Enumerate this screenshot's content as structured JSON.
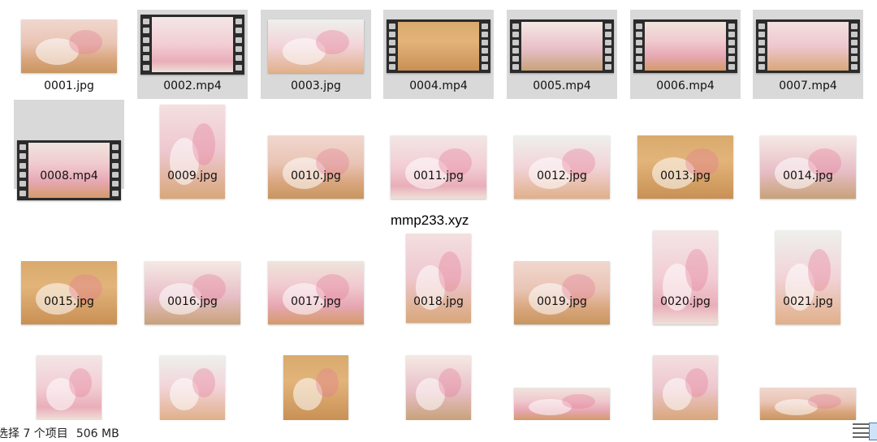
{
  "files": [
    {
      "name": "0001.jpg",
      "type": "image",
      "selected": false
    },
    {
      "name": "0002.mp4",
      "type": "video",
      "selected": true
    },
    {
      "name": "0003.jpg",
      "type": "image",
      "selected": true
    },
    {
      "name": "0004.mp4",
      "type": "video",
      "selected": true
    },
    {
      "name": "0005.mp4",
      "type": "video",
      "selected": true
    },
    {
      "name": "0006.mp4",
      "type": "video",
      "selected": true
    },
    {
      "name": "0007.mp4",
      "type": "video",
      "selected": true
    },
    {
      "name": "0008.mp4",
      "type": "video",
      "selected": true
    },
    {
      "name": "0009.jpg",
      "type": "image",
      "selected": false
    },
    {
      "name": "0010.jpg",
      "type": "image",
      "selected": false
    },
    {
      "name": "0011.jpg",
      "type": "image",
      "selected": false
    },
    {
      "name": "0012.jpg",
      "type": "image",
      "selected": false
    },
    {
      "name": "0013.jpg",
      "type": "image",
      "selected": false
    },
    {
      "name": "0014.jpg",
      "type": "image",
      "selected": false
    },
    {
      "name": "0015.jpg",
      "type": "image",
      "selected": false
    },
    {
      "name": "0016.jpg",
      "type": "image",
      "selected": false
    },
    {
      "name": "0017.jpg",
      "type": "image",
      "selected": false
    },
    {
      "name": "0018.jpg",
      "type": "image",
      "selected": false
    },
    {
      "name": "0019.jpg",
      "type": "image",
      "selected": false
    },
    {
      "name": "0020.jpg",
      "type": "image",
      "selected": false
    },
    {
      "name": "0021.jpg",
      "type": "image",
      "selected": false
    },
    {
      "name": "",
      "type": "image",
      "selected": false
    },
    {
      "name": "",
      "type": "image",
      "selected": false
    },
    {
      "name": "",
      "type": "image",
      "selected": false
    },
    {
      "name": "",
      "type": "image",
      "selected": false
    },
    {
      "name": "",
      "type": "image",
      "selected": false
    },
    {
      "name": "",
      "type": "image",
      "selected": false
    },
    {
      "name": "",
      "type": "image",
      "selected": false
    }
  ],
  "watermark": "mmp233.xyz",
  "status": {
    "selection": "选择 7 个项目",
    "size": "506 MB"
  },
  "icons": {
    "details_view": "details-view-icon",
    "large_icons_view": "large-icons-view-icon"
  }
}
